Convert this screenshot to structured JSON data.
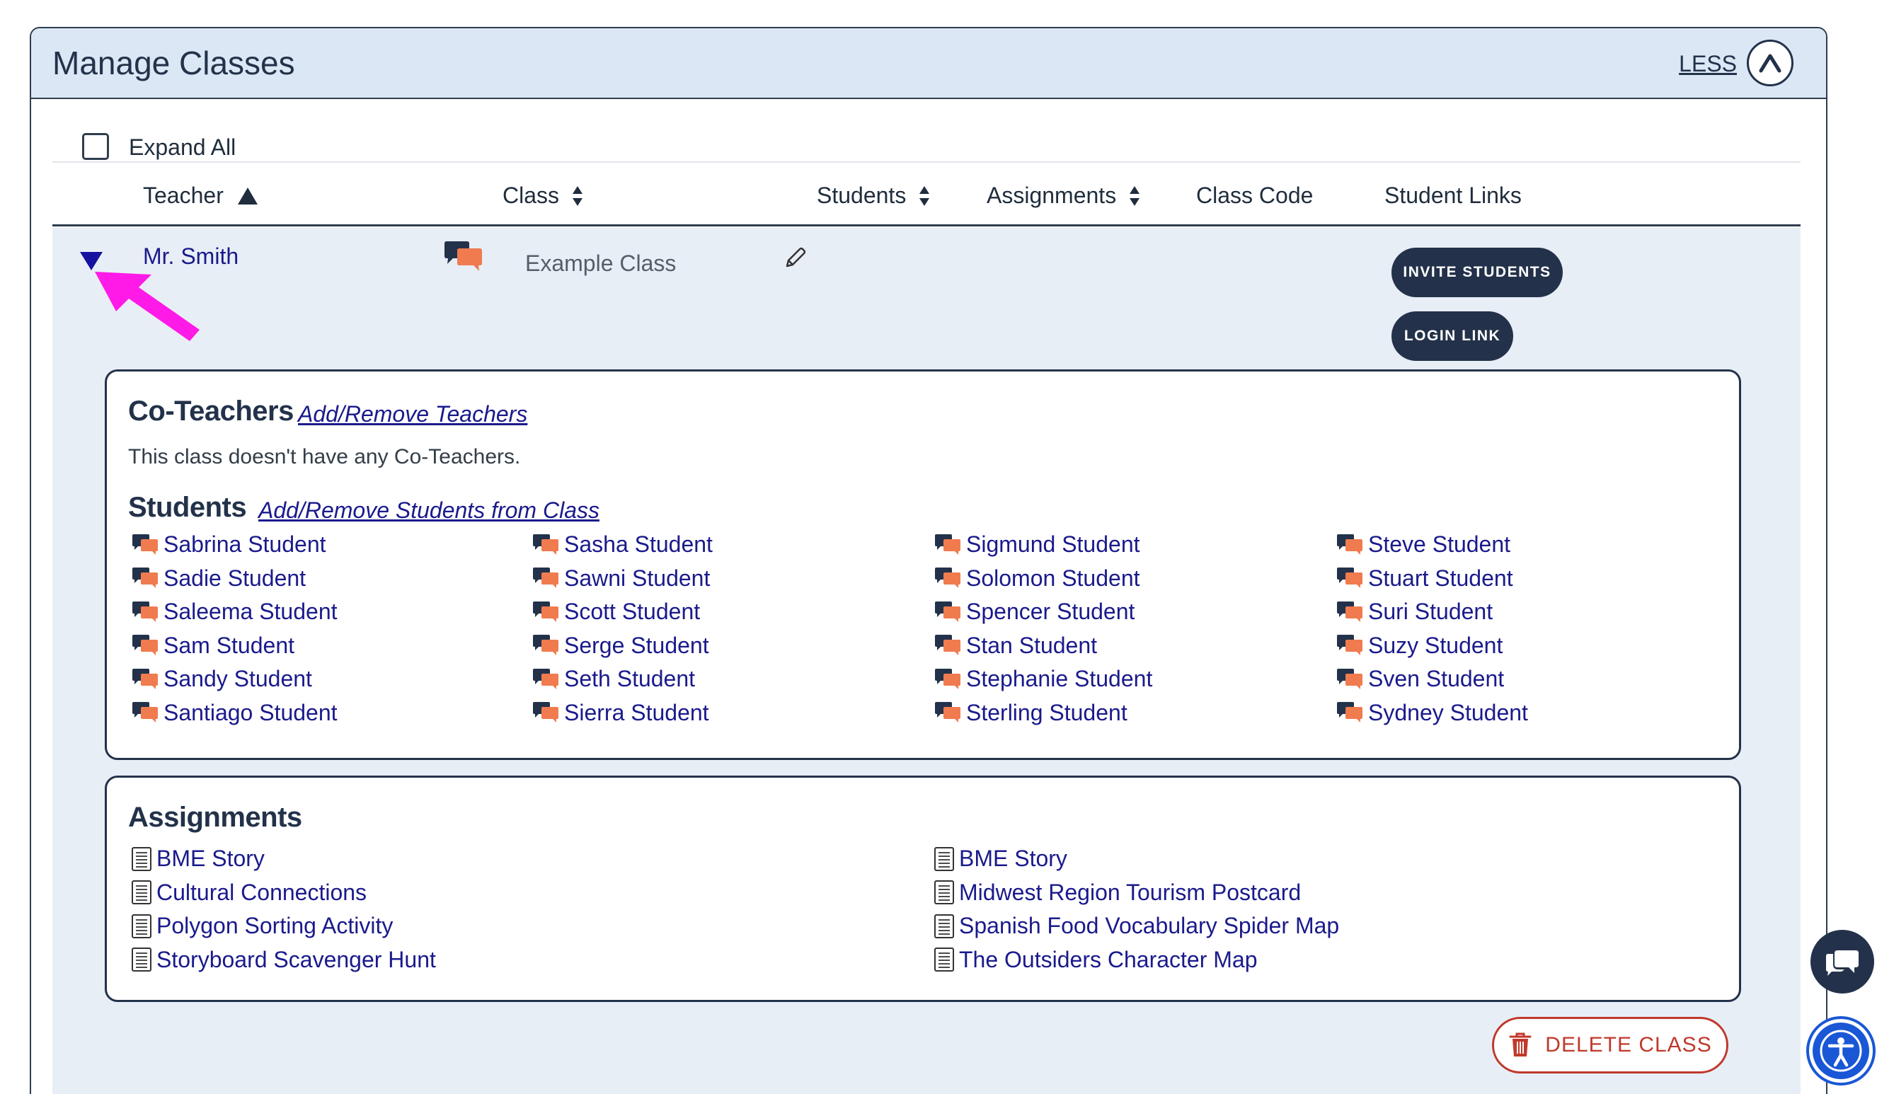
{
  "header": {
    "title": "Manage Classes",
    "less_label": "LESS"
  },
  "expand_all_label": "Expand All",
  "columns": [
    {
      "label": "Teacher",
      "sort": "asc"
    },
    {
      "label": "Class",
      "sort": "both"
    },
    {
      "label": "Students",
      "sort": "both"
    },
    {
      "label": "Assignments",
      "sort": "both"
    },
    {
      "label": "Class Code",
      "sort": "none"
    },
    {
      "label": "Student Links",
      "sort": "none"
    }
  ],
  "class_row": {
    "teacher": "Mr. Smith",
    "class_name": "Example Class",
    "invite_label": "INVITE STUDENTS",
    "login_label": "LOGIN LINK"
  },
  "co_teachers": {
    "heading": "Co-Teachers",
    "link": "Add/Remove Teachers",
    "empty_text": "This class doesn't have any Co-Teachers."
  },
  "students": {
    "heading": "Students",
    "link": "Add/Remove Students from Class",
    "columns": [
      [
        "Sabrina Student",
        "Sadie Student",
        "Saleema Student",
        "Sam Student",
        "Sandy Student",
        "Santiago Student"
      ],
      [
        "Sasha Student",
        "Sawni Student",
        "Scott Student",
        "Serge Student",
        "Seth Student",
        "Sierra Student"
      ],
      [
        "Sigmund Student",
        "Solomon Student",
        "Spencer Student",
        "Stan Student",
        "Stephanie Student",
        "Sterling Student"
      ],
      [
        "Steve Student",
        "Stuart Student",
        "Suri Student",
        "Suzy Student",
        "Sven Student",
        "Sydney Student"
      ]
    ]
  },
  "assignments": {
    "heading": "Assignments",
    "columns": [
      [
        "BME Story",
        "Cultural Connections",
        "Polygon Sorting Activity",
        "Storyboard Scavenger Hunt"
      ],
      [
        "BME Story",
        "Midwest Region Tourism Postcard",
        "Spanish Food Vocabulary Spider Map",
        "The Outsiders Character Map"
      ]
    ]
  },
  "delete_label": "DELETE CLASS",
  "colors": {
    "navy": "#23324a",
    "link": "#1a1a8c",
    "header_bg": "#dbe7f5",
    "row_bg": "#e8eef6",
    "chat_orange": "#f07b4f",
    "delete_red": "#c0392b",
    "annotation_magenta": "#ff1ae8",
    "accessibility_blue": "#1a57d6"
  },
  "icons": [
    "chevron-up-icon",
    "sort-asc-icon",
    "sort-icon",
    "expand-triangle-icon",
    "chat-icon",
    "pencil-icon",
    "document-icon",
    "trash-icon",
    "accessibility-icon"
  ]
}
